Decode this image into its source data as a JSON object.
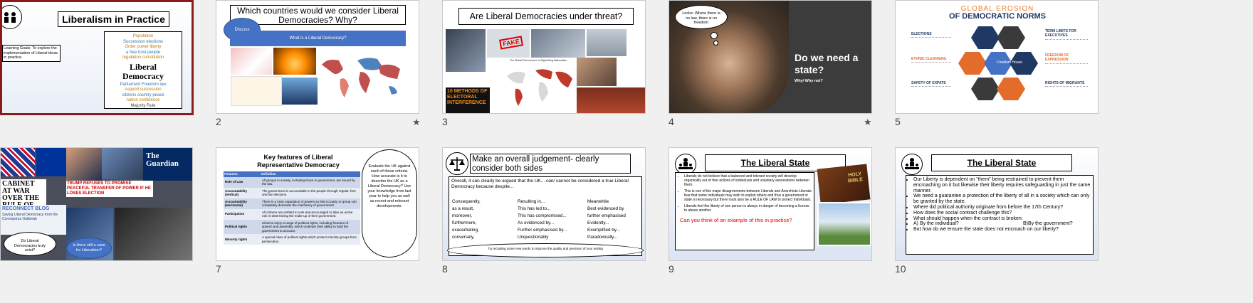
{
  "slides": [
    {
      "num": "",
      "title": "Liberalism in Practice",
      "learning": "Learning Goals: To explore the implementation of Liberal ideas in practice.",
      "cloud_main": "Liberal Democracy",
      "words": [
        "Population",
        "Succession elections",
        "Order power liberty",
        "a free trust people",
        "regulation constitution",
        "Parliament Freedom law",
        "support succession",
        "citizens country peace",
        "nation confidence",
        "Majority Rule"
      ]
    },
    {
      "num": "2",
      "title": "Which countries would we consider Liberal Democracies? Why?",
      "discuss": "Discuss",
      "banner": "What is a Liberal Democracy?"
    },
    {
      "num": "3",
      "title": "Are Liberal Democracies under threat?",
      "fake": "FAKE",
      "methods": "10 METHODS OF ELECTORAL INTERFERENCE",
      "map_title": "The Global Phenomenon of Right-Wing Nationalism"
    },
    {
      "num": "4",
      "quote": "Locke: Where there is no law, there is no freedom",
      "q_title": "Do we need a state?",
      "q_sub": "Why/ Why not?"
    },
    {
      "num": "5",
      "title1": "GLOBAL EROSION",
      "title2": "OF DEMOCRATIC NORMS",
      "left": [
        "ELECTIONS",
        "ETHNIC CLEANSING",
        "SAFETY OF EXPATS"
      ],
      "right": [
        "TERM LIMITS FOR EXECUTIVES",
        "FREEDOM OF EXPRESSION",
        "RIGHTS OF MIGRANTS"
      ],
      "center": "Freedom House"
    },
    {
      "num": "",
      "headline": "TRUMP REFUSES TO PROMISE PEACEFUL TRANSFER OF POWER IF HE LOSES ELECTION",
      "guardian": "The Guardian",
      "cabinet": "CABINET AT WAR OVER THE RULE OF LAW",
      "blog": "RECONNECT BLOG",
      "blog_sub": "Saving Liberal Democracy from the Coronavirus Outbreak",
      "cloud1": "Do Liberal Democracies truly exist?",
      "cloud2": "Is there still a case for Liberalism?"
    },
    {
      "num": "7",
      "title": "Key features of Liberal Representative Democracy",
      "head": [
        "Features",
        "Definition"
      ],
      "rows": [
        [
          "Rule of Law",
          "All groups in society, including those in government, are bound by the law."
        ],
        [
          "Accountability (Vertical)",
          "The government is accountable to the people through regular, free and fair elections."
        ],
        [
          "Accountability (Horizontal)",
          "There is a clear separation of powers so that no party or group can completely dominate the machinery of government."
        ],
        [
          "Participation",
          "All citizens are entitled to vote and encouraged to take an active role in determining the make-up of their government."
        ],
        [
          "Political rights",
          "Citizens enjoy a range of political rights, including freedom of speech and assembly, which underpin their ability to hold the government to account."
        ],
        [
          "Minority rights",
          "A special class of political rights which protect minority groups from persecution."
        ]
      ],
      "cloud": "Evaluate the UK against each of these criteria. How accurate is it to describe the UK as a Liberal Democracy? Use your knowledge from last year to help you as well as recent and relevant developments."
    },
    {
      "num": "8",
      "title": "Make an overall judgement- clearly consider both sides",
      "intro": "Overall, it can clearly be argued that the UK... can/ cannot be considered a true Liberal Democracy because despite...",
      "col1": [
        "Consequently,",
        "as a result,",
        "moreover,",
        "furthermore,",
        "exacerbating,",
        "conversely,"
      ],
      "col2": [
        "Resulting in...",
        "This has led to...",
        "This has compromised...",
        "As evidenced by...",
        "Further emphasised by...",
        "Unquestionably"
      ],
      "col3": [
        "Meanwhile",
        "Best evidenced by",
        "further emphasised",
        "Evidently...",
        "Exemplified by...",
        "Paradoxically..."
      ],
      "footer": "Try including some new words to improve the quality and precision of your writing"
    },
    {
      "num": "9",
      "title": "The Liberal State",
      "bullets": [
        "Liberals do not believe that a balanced and tolerant society will develop organically out of free actions of individuals and voluntary associations between them.",
        "This is one of the major disagreements between Liberals and Anarchists-Liberals fear that some individuals may wish to exploit others and thus a government or state is necessary but there must also be a RULE OF LAW to protect individuals.",
        "Liberals feel the liberty of one person is always in danger of becoming a license to abuse another."
      ],
      "red": "Can you think of an example of this in practice?",
      "bible": "HOLY BIBLE"
    },
    {
      "num": "10",
      "title": "The Liberal State",
      "bullets": [
        "Our Liberty is dependent on “them” being restrained to prevent them encroaching on it but likewise their liberty requires safeguarding in just the same manner.",
        "We need a guarantee a protection of the liberty of all in a society which can only be granted by the state.",
        "Where did political authority originate from before the 17th Century?",
        "How does the social contract challenge this?",
        "What should happen when the contract is broken:",
        "A) By the individual?",
        "But how do we ensure the state does not encroach on our liberty?"
      ],
      "b_option": "B)By the government?"
    }
  ],
  "colors": {
    "selected_border": "#8b1a1a",
    "slide_bg": "#ffffff",
    "panel_bg": "#f0f0f0",
    "accent_blue": "#4472c4",
    "dark_blue": "#1f3864",
    "orange": "#e46c2a",
    "red_text": "#e00000"
  }
}
